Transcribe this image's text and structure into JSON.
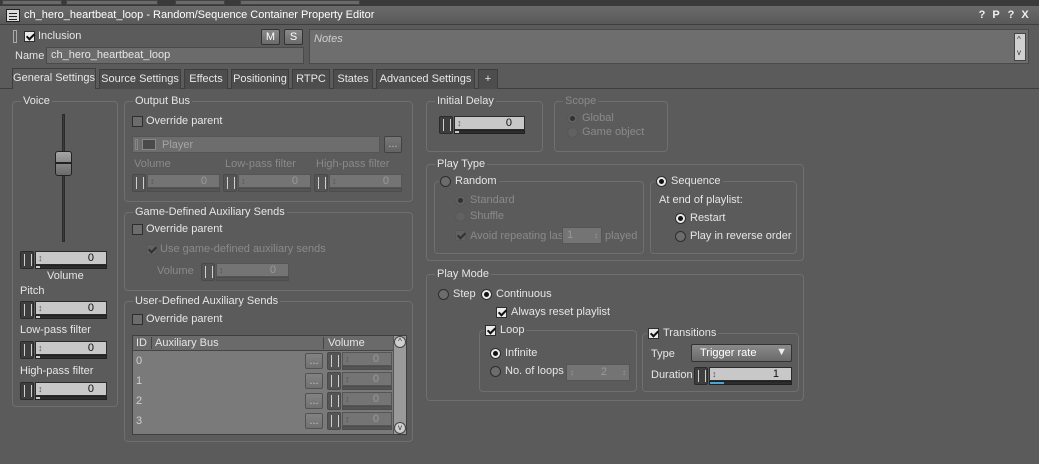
{
  "window": {
    "title": "ch_hero_heartbeat_loop - Random/Sequence Container Property Editor",
    "title_buttons": [
      "?",
      "P",
      "?",
      "X"
    ]
  },
  "header": {
    "inclusion_label": "Inclusion",
    "inclusion_checked": true,
    "m_label": "M",
    "s_label": "S",
    "name_label": "Name",
    "name_value": "ch_hero_heartbeat_loop",
    "notes_placeholder": "Notes",
    "notes_up": "^",
    "notes_down": "v"
  },
  "tabs": [
    {
      "label": "General Settings",
      "active": true
    },
    {
      "label": "Source Settings"
    },
    {
      "label": "Effects"
    },
    {
      "label": "Positioning"
    },
    {
      "label": "RTPC"
    },
    {
      "label": "States"
    },
    {
      "label": "Advanced Settings"
    },
    {
      "label": "+"
    }
  ],
  "voice": {
    "group_title": "Voice",
    "volume_value": "0",
    "volume_label": "Volume",
    "pitch_label": "Pitch",
    "pitch_value": "0",
    "lowpass_label": "Low-pass filter",
    "lowpass_value": "0",
    "highpass_label": "High-pass filter",
    "highpass_value": "0"
  },
  "output_bus": {
    "group_title": "Output Bus",
    "override_label": "Override parent",
    "bus_name": "Player",
    "browse_label": "...",
    "volume_label": "Volume",
    "lowpass_label": "Low-pass filter",
    "highpass_label": "High-pass filter",
    "volume_value": "0",
    "lowpass_value": "0",
    "highpass_value": "0"
  },
  "game_aux": {
    "group_title": "Game-Defined Auxiliary Sends",
    "override_label": "Override parent",
    "use_label": "Use game-defined auxiliary sends",
    "volume_label": "Volume",
    "volume_value": "0"
  },
  "user_aux": {
    "group_title": "User-Defined Auxiliary Sends",
    "override_label": "Override parent",
    "columns": [
      "ID",
      "Auxiliary Bus",
      "Volume"
    ],
    "rows": [
      {
        "id": "0",
        "volume": "0"
      },
      {
        "id": "1",
        "volume": "0"
      },
      {
        "id": "2",
        "volume": "0"
      },
      {
        "id": "3",
        "volume": "0"
      }
    ],
    "row_button": "...",
    "scroll_up": "^",
    "scroll_down": "v"
  },
  "initial_delay": {
    "group_title": "Initial Delay",
    "value": "0"
  },
  "scope": {
    "group_title": "Scope",
    "options": [
      "Global",
      "Game object"
    ]
  },
  "play_type": {
    "group_title": "Play Type",
    "random_label": "Random",
    "standard_label": "Standard",
    "shuffle_label": "Shuffle",
    "avoid_label": "Avoid repeating last",
    "avoid_value": "1",
    "played_label": "played",
    "sequence_label": "Sequence",
    "end_label": "At end of playlist:",
    "restart_label": "Restart",
    "reverse_label": "Play in reverse order"
  },
  "play_mode": {
    "group_title": "Play Mode",
    "step_label": "Step",
    "continuous_label": "Continuous",
    "always_reset_label": "Always reset playlist",
    "loop_label": "Loop",
    "infinite_label": "Infinite",
    "no_loops_label": "No. of loops",
    "no_loops_value": "2",
    "transitions_label": "Transitions",
    "type_label": "Type",
    "type_value": "Trigger rate",
    "duration_label": "Duration",
    "duration_value": "1"
  }
}
